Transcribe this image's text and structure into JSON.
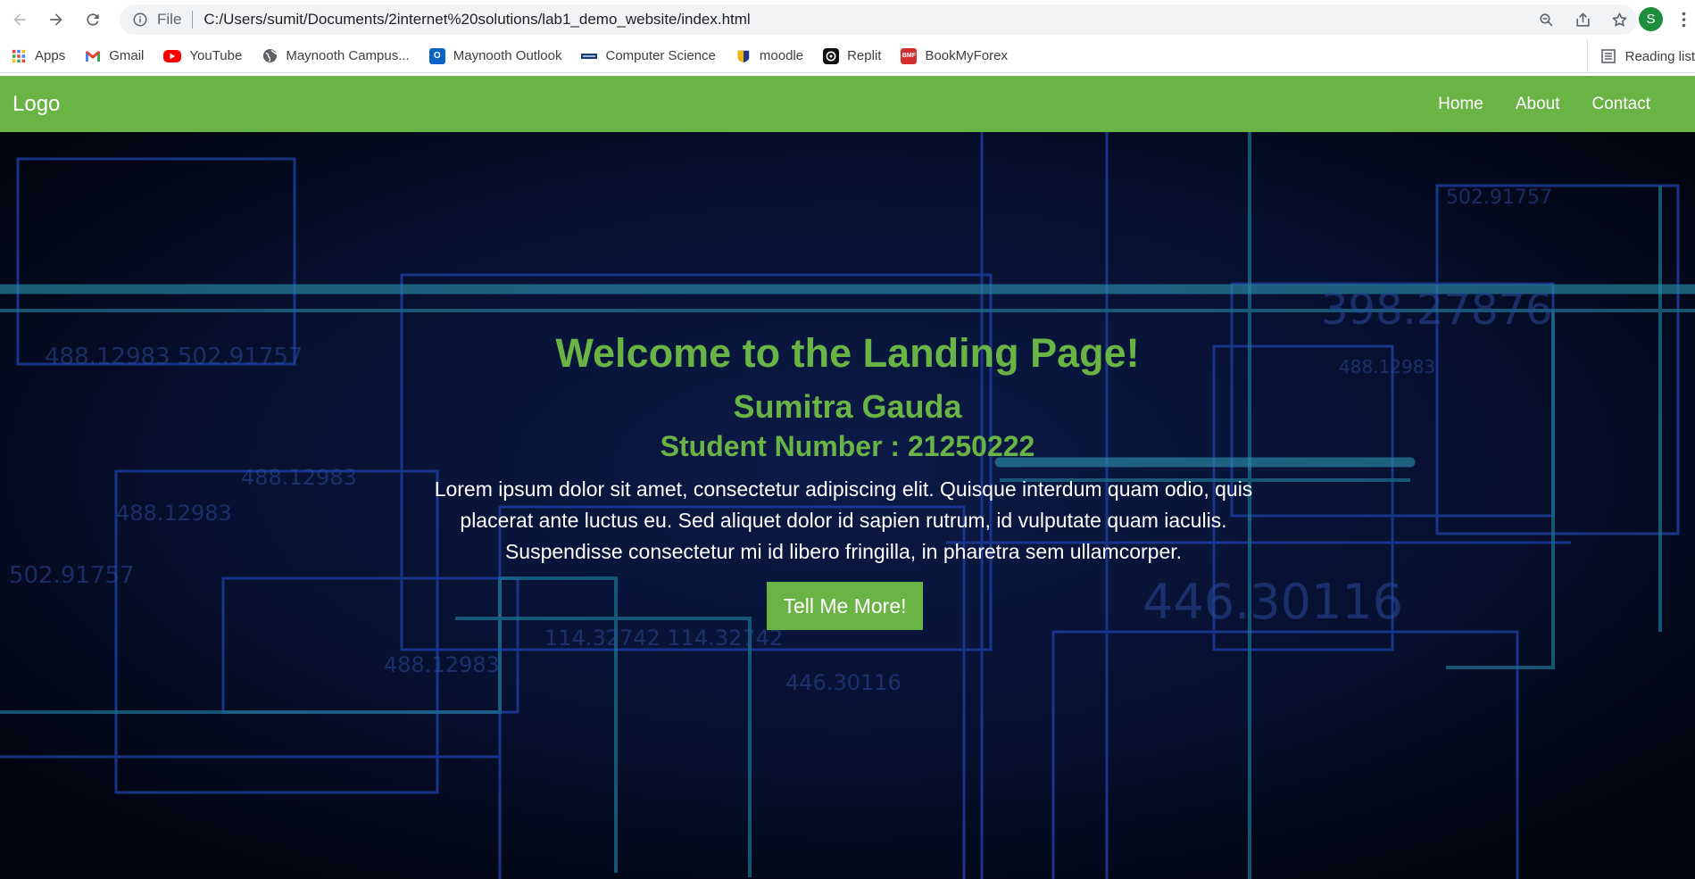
{
  "browser": {
    "file_label": "File",
    "url": "C:/Users/sumit/Documents/2internet%20solutions/lab1_demo_website/index.html",
    "profile_initial": "S",
    "bookmarks": [
      {
        "label": "Apps",
        "icon": "apps-grid-icon"
      },
      {
        "label": "Gmail",
        "icon": "gmail-icon"
      },
      {
        "label": "YouTube",
        "icon": "youtube-icon"
      },
      {
        "label": "Maynooth Campus...",
        "icon": "globe-icon"
      },
      {
        "label": "Maynooth Outlook",
        "icon": "outlook-icon"
      },
      {
        "label": "Computer Science",
        "icon": "cs-icon"
      },
      {
        "label": "moodle",
        "icon": "moodle-icon"
      },
      {
        "label": "Replit",
        "icon": "replit-icon"
      },
      {
        "label": "BookMyForex",
        "icon": "bookmyforex-icon"
      }
    ],
    "reading_list_label": "Reading list"
  },
  "site": {
    "logo": "Logo",
    "nav": [
      "Home",
      "About",
      "Contact"
    ],
    "accent_color": "#6ab446"
  },
  "hero": {
    "title": "Welcome to the Landing Page!",
    "name": "Sumitra Gauda",
    "student_number": "Student Number : 21250222",
    "text": "Lorem ipsum dolor sit amet, consectetur adipiscing elit. Quisque interdum quam odio, quis placerat ante luctus eu. Sed aliquet dolor id sapien rutrum, id vulputate quam iaculis. Suspendisse consectetur mi id libero fringilla, in pharetra sem ullamcorper.",
    "button": "Tell Me More!",
    "background_numbers": [
      "488.12983",
      "502.91757",
      "398.27876",
      "114.32742",
      "446.30116",
      "488.12983",
      "488.12983",
      "502.91757",
      "488.12983",
      "446.30116",
      "114.32742"
    ]
  }
}
